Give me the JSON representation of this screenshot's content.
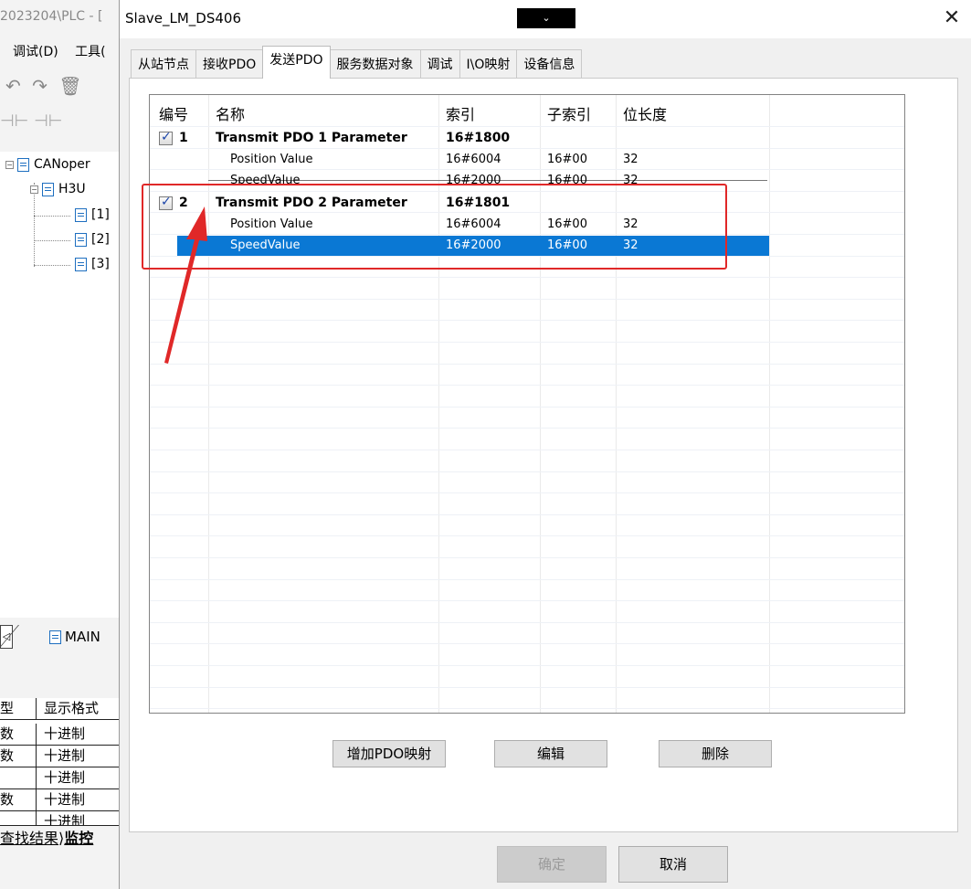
{
  "ide": {
    "title": "2023204\\PLC - [",
    "menu": [
      "调试(D)",
      "工具("
    ],
    "tree": {
      "root": "CANoper",
      "child": "H3U",
      "leaves": [
        "[1]",
        "[2]",
        "[3]"
      ]
    },
    "tab_main": "MAIN",
    "grid_header": [
      "型",
      "显示格式"
    ],
    "grid_rows": [
      [
        "数",
        "十进制"
      ],
      [
        "数",
        "十进制"
      ],
      [
        "",
        "十进制"
      ],
      [
        "数",
        "十进制"
      ],
      [
        "",
        "十进制"
      ]
    ],
    "bottom_tabs": [
      "查找结果",
      "监控"
    ]
  },
  "dialog": {
    "title": "Slave_LM_DS406",
    "close": "✕",
    "dropdown_glyph": "⌄",
    "tabs": [
      {
        "label": "从站节点",
        "active": false
      },
      {
        "label": "接收PDO",
        "active": false
      },
      {
        "label": "发送PDO",
        "active": true
      },
      {
        "label": "服务数据对象",
        "active": false
      },
      {
        "label": "调试",
        "active": false
      },
      {
        "label": "I\\O映射",
        "active": false
      },
      {
        "label": "设备信息",
        "active": false
      }
    ],
    "table": {
      "headers": [
        "编号",
        "名称",
        "索引",
        "子索引",
        "位长度"
      ],
      "rows": [
        {
          "no": "1",
          "name": "Transmit PDO 1 Parameter",
          "index": "16#1800",
          "sub": "",
          "len": "",
          "bold": true,
          "checked": true
        },
        {
          "no": "",
          "name": "Position Value",
          "index": "16#6004",
          "sub": "16#00",
          "len": "32",
          "bold": false
        },
        {
          "no": "",
          "name": "SpeedValue",
          "index": "16#2000",
          "sub": "16#00",
          "len": "32",
          "bold": false
        },
        {
          "no": "2",
          "name": "Transmit PDO 2 Parameter",
          "index": "16#1801",
          "sub": "",
          "len": "",
          "bold": true,
          "checked": true
        },
        {
          "no": "",
          "name": "Position Value",
          "index": "16#6004",
          "sub": "16#00",
          "len": "32",
          "bold": false
        },
        {
          "no": "",
          "name": "SpeedValue",
          "index": "16#2000",
          "sub": "16#00",
          "len": "32",
          "bold": false,
          "selected": true
        }
      ]
    },
    "buttons": {
      "add": "增加PDO映射",
      "edit": "编辑",
      "delete": "删除",
      "ok": "确定",
      "cancel": "取消"
    }
  },
  "colors": {
    "selection": "#0a78d4",
    "annotation": "#e02828"
  }
}
